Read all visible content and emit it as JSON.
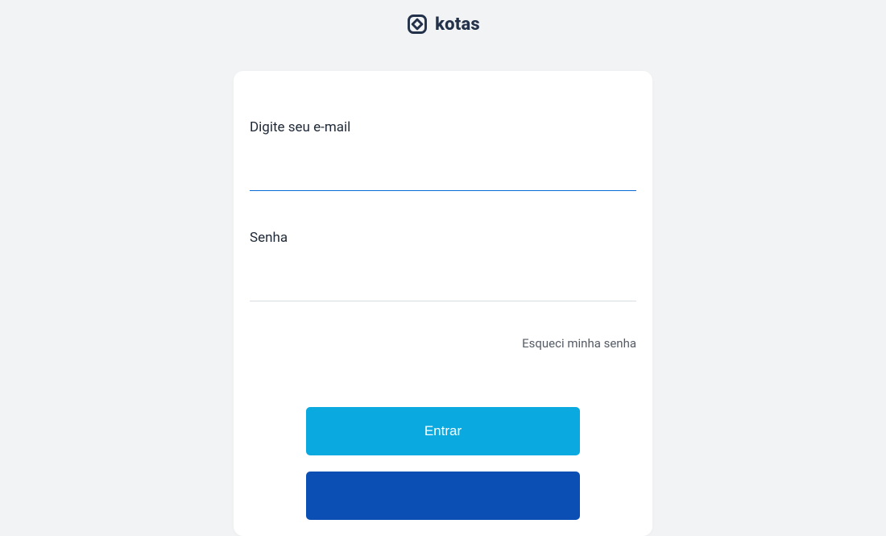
{
  "brand": {
    "name": "kotas",
    "colors": {
      "logo_text": "#23324a",
      "primary_button": "#0aa9e0",
      "secondary_button": "#0b4fb5"
    }
  },
  "form": {
    "email_label": "Digite seu e-mail",
    "email_value": "",
    "password_label": "Senha",
    "password_value": "",
    "forgot_password": "Esqueci minha senha",
    "submit_label": "Entrar"
  }
}
